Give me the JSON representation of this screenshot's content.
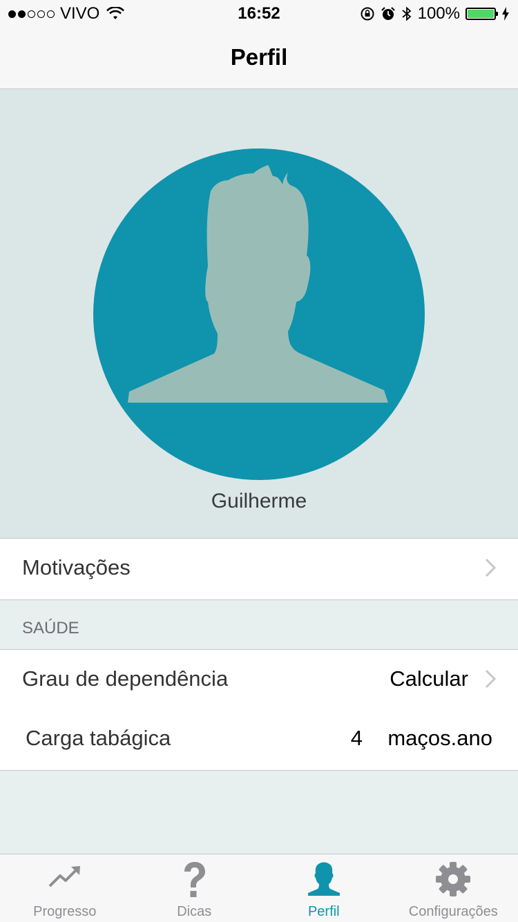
{
  "status_bar": {
    "carrier": "VIVO",
    "time": "16:52",
    "battery": "100%",
    "battery_level": 1.0,
    "signal_bars_filled": 2,
    "signal_bars_total": 5
  },
  "nav": {
    "title": "Perfil"
  },
  "profile": {
    "name": "Guilherme",
    "avatar_bg_color": "#1093ad",
    "silhouette_color": "#99bdb6"
  },
  "rows": {
    "motivacoes": {
      "label": "Motivações"
    },
    "section_saude": "SAÚDE",
    "grau": {
      "label": "Grau de dependência",
      "value": "Calcular"
    },
    "carga": {
      "label": "Carga tabágica",
      "value": "4",
      "unit": "maços.ano"
    }
  },
  "tabs": [
    {
      "label": "Progresso",
      "icon": "trend-up-icon",
      "active": false
    },
    {
      "label": "Dicas",
      "icon": "question-icon",
      "active": false
    },
    {
      "label": "Perfil",
      "icon": "person-icon",
      "active": true
    },
    {
      "label": "Configurações",
      "icon": "gear-icon",
      "active": false
    }
  ],
  "colors": {
    "accent": "#1093ad",
    "inactive_tab": "#8e8e93",
    "battery": "#4cd964"
  }
}
